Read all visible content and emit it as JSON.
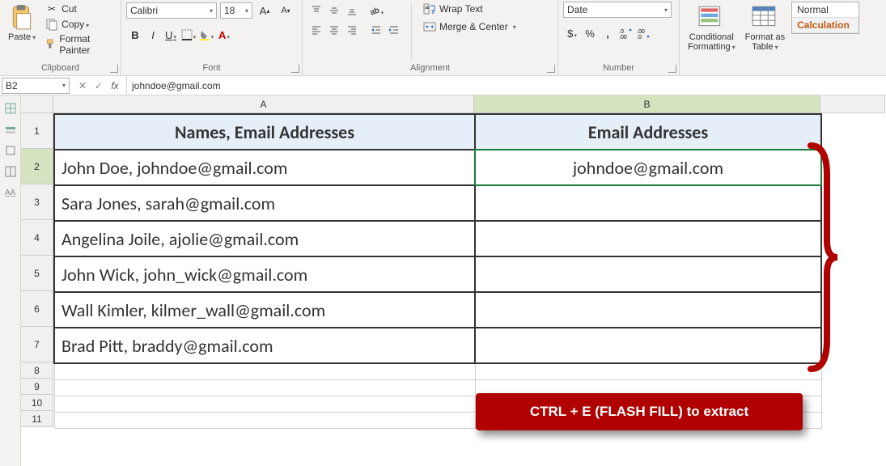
{
  "ribbon": {
    "clipboard": {
      "paste_label": "Paste",
      "cut_label": "Cut",
      "copy_label": "Copy",
      "format_painter_label": "Format Painter",
      "group_label": "Clipboard"
    },
    "font": {
      "name": "Calibri",
      "size": "18",
      "bold": "B",
      "italic": "I",
      "underline": "U",
      "group_label": "Font"
    },
    "alignment": {
      "wrap_label": "Wrap Text",
      "merge_label": "Merge & Center",
      "group_label": "Alignment"
    },
    "number": {
      "format": "Date",
      "currency_sym": "$",
      "percent_sym": "%",
      "comma_sym": ",",
      "group_label": "Number"
    },
    "styles": {
      "cond_label": "Conditional\nFormatting",
      "table_label": "Format as\nTable",
      "normal": "Normal",
      "calculation": "Calculation"
    }
  },
  "namebox": "B2",
  "formula_bar": "johndoe@gmail.com",
  "columns": [
    "A",
    "B"
  ],
  "rows": [
    "1",
    "2",
    "3",
    "4",
    "5",
    "6",
    "7",
    "8",
    "9",
    "10",
    "11"
  ],
  "sheet": {
    "headers": {
      "A": "Names, Email Addresses",
      "B": "Email Addresses"
    },
    "data": [
      {
        "A": "John Doe, johndoe@gmail.com",
        "B": "johndoe@gmail.com"
      },
      {
        "A": "Sara Jones, sarah@gmail.com",
        "B": ""
      },
      {
        "A": "Angelina Joile, ajolie@gmail.com",
        "B": ""
      },
      {
        "A": "John Wick, john_wick@gmail.com",
        "B": ""
      },
      {
        "A": "Wall Kimler, kilmer_wall@gmail.com",
        "B": ""
      },
      {
        "A": "Brad Pitt, braddy@gmail.com",
        "B": ""
      }
    ]
  },
  "callout": "CTRL + E (FLASH FILL) to extract",
  "chart_data": {
    "type": "table",
    "title": "Flash Fill email extraction example",
    "columns": [
      "Names, Email Addresses",
      "Email Addresses"
    ],
    "rows": [
      [
        "John Doe, johndoe@gmail.com",
        "johndoe@gmail.com"
      ],
      [
        "Sara Jones, sarah@gmail.com",
        ""
      ],
      [
        "Angelina Joile, ajolie@gmail.com",
        ""
      ],
      [
        "John Wick, john_wick@gmail.com",
        ""
      ],
      [
        "Wall Kimler, kilmer_wall@gmail.com",
        ""
      ],
      [
        "Brad Pitt, braddy@gmail.com",
        ""
      ]
    ]
  }
}
